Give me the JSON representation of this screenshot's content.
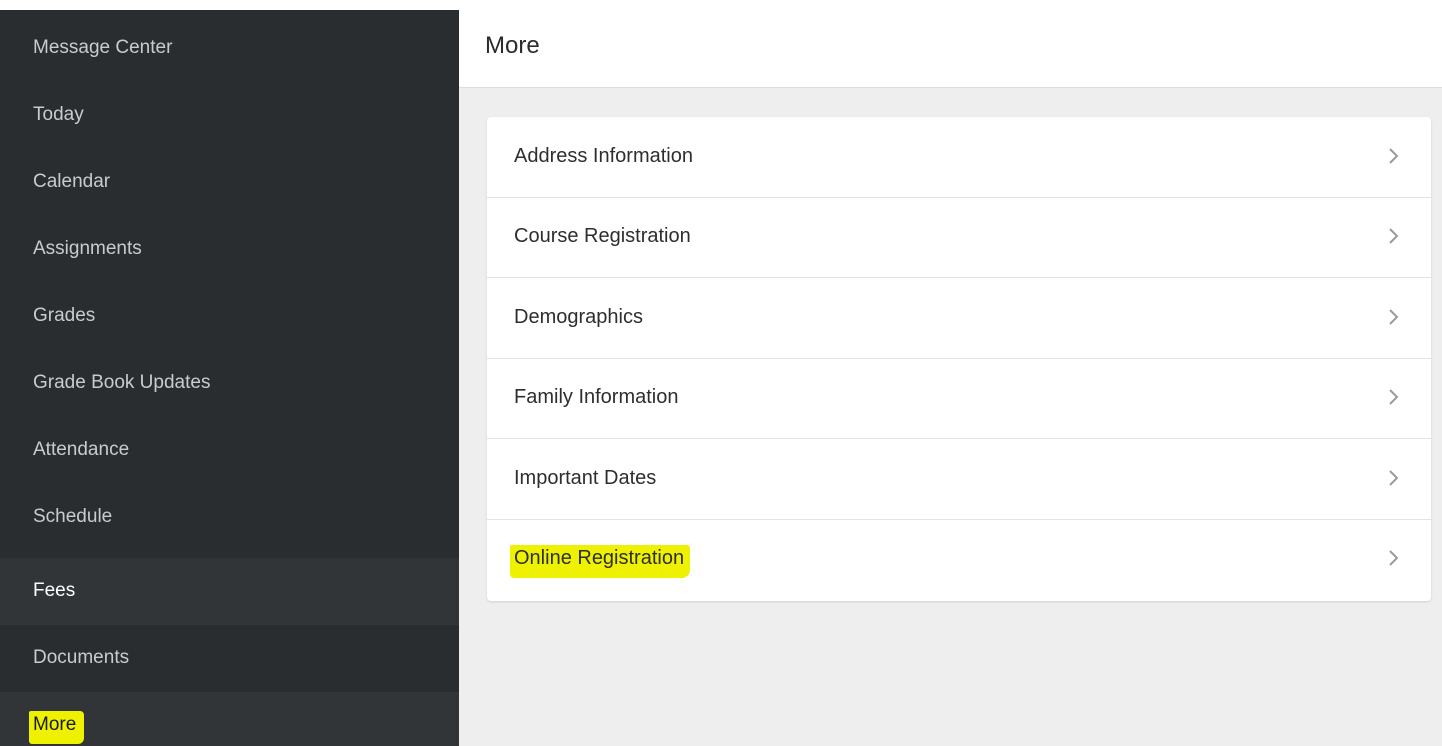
{
  "sidebar": {
    "items": [
      {
        "label": "Message Center"
      },
      {
        "label": "Today"
      },
      {
        "label": "Calendar"
      },
      {
        "label": "Assignments"
      },
      {
        "label": "Grades"
      },
      {
        "label": "Grade Book Updates"
      },
      {
        "label": "Attendance"
      },
      {
        "label": "Schedule"
      },
      {
        "label": "Fees"
      },
      {
        "label": "Documents"
      },
      {
        "label": "More"
      }
    ]
  },
  "header": {
    "title": "More"
  },
  "list": {
    "items": [
      {
        "label": "Address Information"
      },
      {
        "label": "Course Registration"
      },
      {
        "label": "Demographics"
      },
      {
        "label": "Family Information"
      },
      {
        "label": "Important Dates"
      },
      {
        "label": "Online Registration"
      }
    ]
  },
  "icons": {
    "row_chevron": "chevron-right-icon"
  },
  "colors": {
    "sidebar_bg": "#2a2d2f",
    "highlight": "#eef200",
    "main_bg": "#eeeeee"
  }
}
